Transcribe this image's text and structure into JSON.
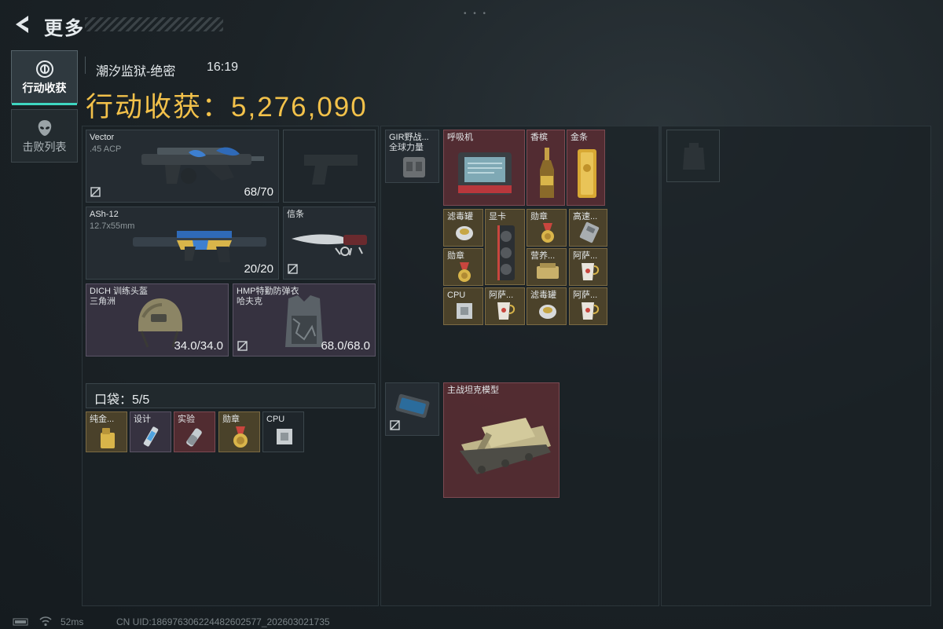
{
  "header": {
    "title": "更多",
    "map_name": "潮汐监狱-绝密",
    "time": "16:19",
    "earnings_label": "行动收获：",
    "earnings_value": "5,276,090"
  },
  "tabs": [
    {
      "label": "行动收获",
      "icon": "target-icon",
      "active": true
    },
    {
      "label": "击败列表",
      "icon": "alien-head-icon",
      "active": false
    }
  ],
  "equipment": {
    "primary_weapon": {
      "name": "Vector",
      "ammo": ".45 ACP",
      "count": "68/70"
    },
    "pistol": {
      "name": ""
    },
    "secondary_weapon": {
      "name": "ASh-12",
      "ammo": "12.7x55mm",
      "count": "20/20"
    },
    "melee": {
      "name": "信条"
    },
    "helmet": {
      "name": "DICH 训练头盔",
      "sub": "三角洲",
      "durability": "34.0/34.0"
    },
    "armor": {
      "name": "HMP特勤防弹衣",
      "sub": "哈夫克",
      "durability": "68.0/68.0"
    }
  },
  "pocket": {
    "label": "口袋：5/5",
    "items": [
      {
        "label": "纯金...",
        "color": "gold",
        "icon": "lighter-icon"
      },
      {
        "label": "设计",
        "color": "purple",
        "icon": "syringe-icon"
      },
      {
        "label": "实验",
        "color": "red",
        "icon": "vial-icon"
      },
      {
        "label": "勋章",
        "color": "gold",
        "icon": "medal-icon"
      },
      {
        "label": "CPU",
        "color": "dark",
        "icon": "cpu-icon"
      }
    ]
  },
  "rig": {
    "name": "GIR野战...",
    "sub": "全球力量"
  },
  "backpack_items": [
    {
      "label": "呼吸机",
      "color": "red",
      "icon": "ventilator-icon"
    },
    {
      "label": "香槟",
      "color": "red",
      "icon": "champagne-icon"
    },
    {
      "label": "金条",
      "color": "red",
      "icon": "gold-bar-icon"
    },
    {
      "label": "滤毒罐",
      "color": "gold",
      "icon": "filter-canister-icon"
    },
    {
      "label": "显卡",
      "color": "gold",
      "icon": "gpu-icon"
    },
    {
      "label": "勋章",
      "color": "gold",
      "icon": "medal-icon"
    },
    {
      "label": "高速...",
      "color": "gold",
      "icon": "drive-icon"
    },
    {
      "label": "勋章",
      "color": "gold",
      "icon": "medal-icon"
    },
    {
      "label": "营养...",
      "color": "gold",
      "icon": "food-box-icon"
    },
    {
      "label": "阿萨...",
      "color": "gold",
      "icon": "cup-icon"
    },
    {
      "label": "CPU",
      "color": "gold",
      "icon": "cpu-icon"
    },
    {
      "label": "阿萨...",
      "color": "gold",
      "icon": "cup-icon"
    },
    {
      "label": "滤毒罐",
      "color": "gold",
      "icon": "filter-canister-icon"
    },
    {
      "label": "阿萨...",
      "color": "gold",
      "icon": "cup-icon"
    }
  ],
  "safe_box": {
    "label": "",
    "icon": "safe-case-icon"
  },
  "tank_model": {
    "label": "主战坦克模型",
    "color": "red",
    "icon": "tank-icon"
  },
  "status": {
    "ping": "52ms",
    "uid": "CN UID:18697630622448260257​7_202603021735"
  },
  "colors": {
    "earnings": "#f2c14a",
    "accent": "#3fd6c0",
    "red_rarity": "#5c2e34",
    "gold_rarity": "#54482c"
  }
}
